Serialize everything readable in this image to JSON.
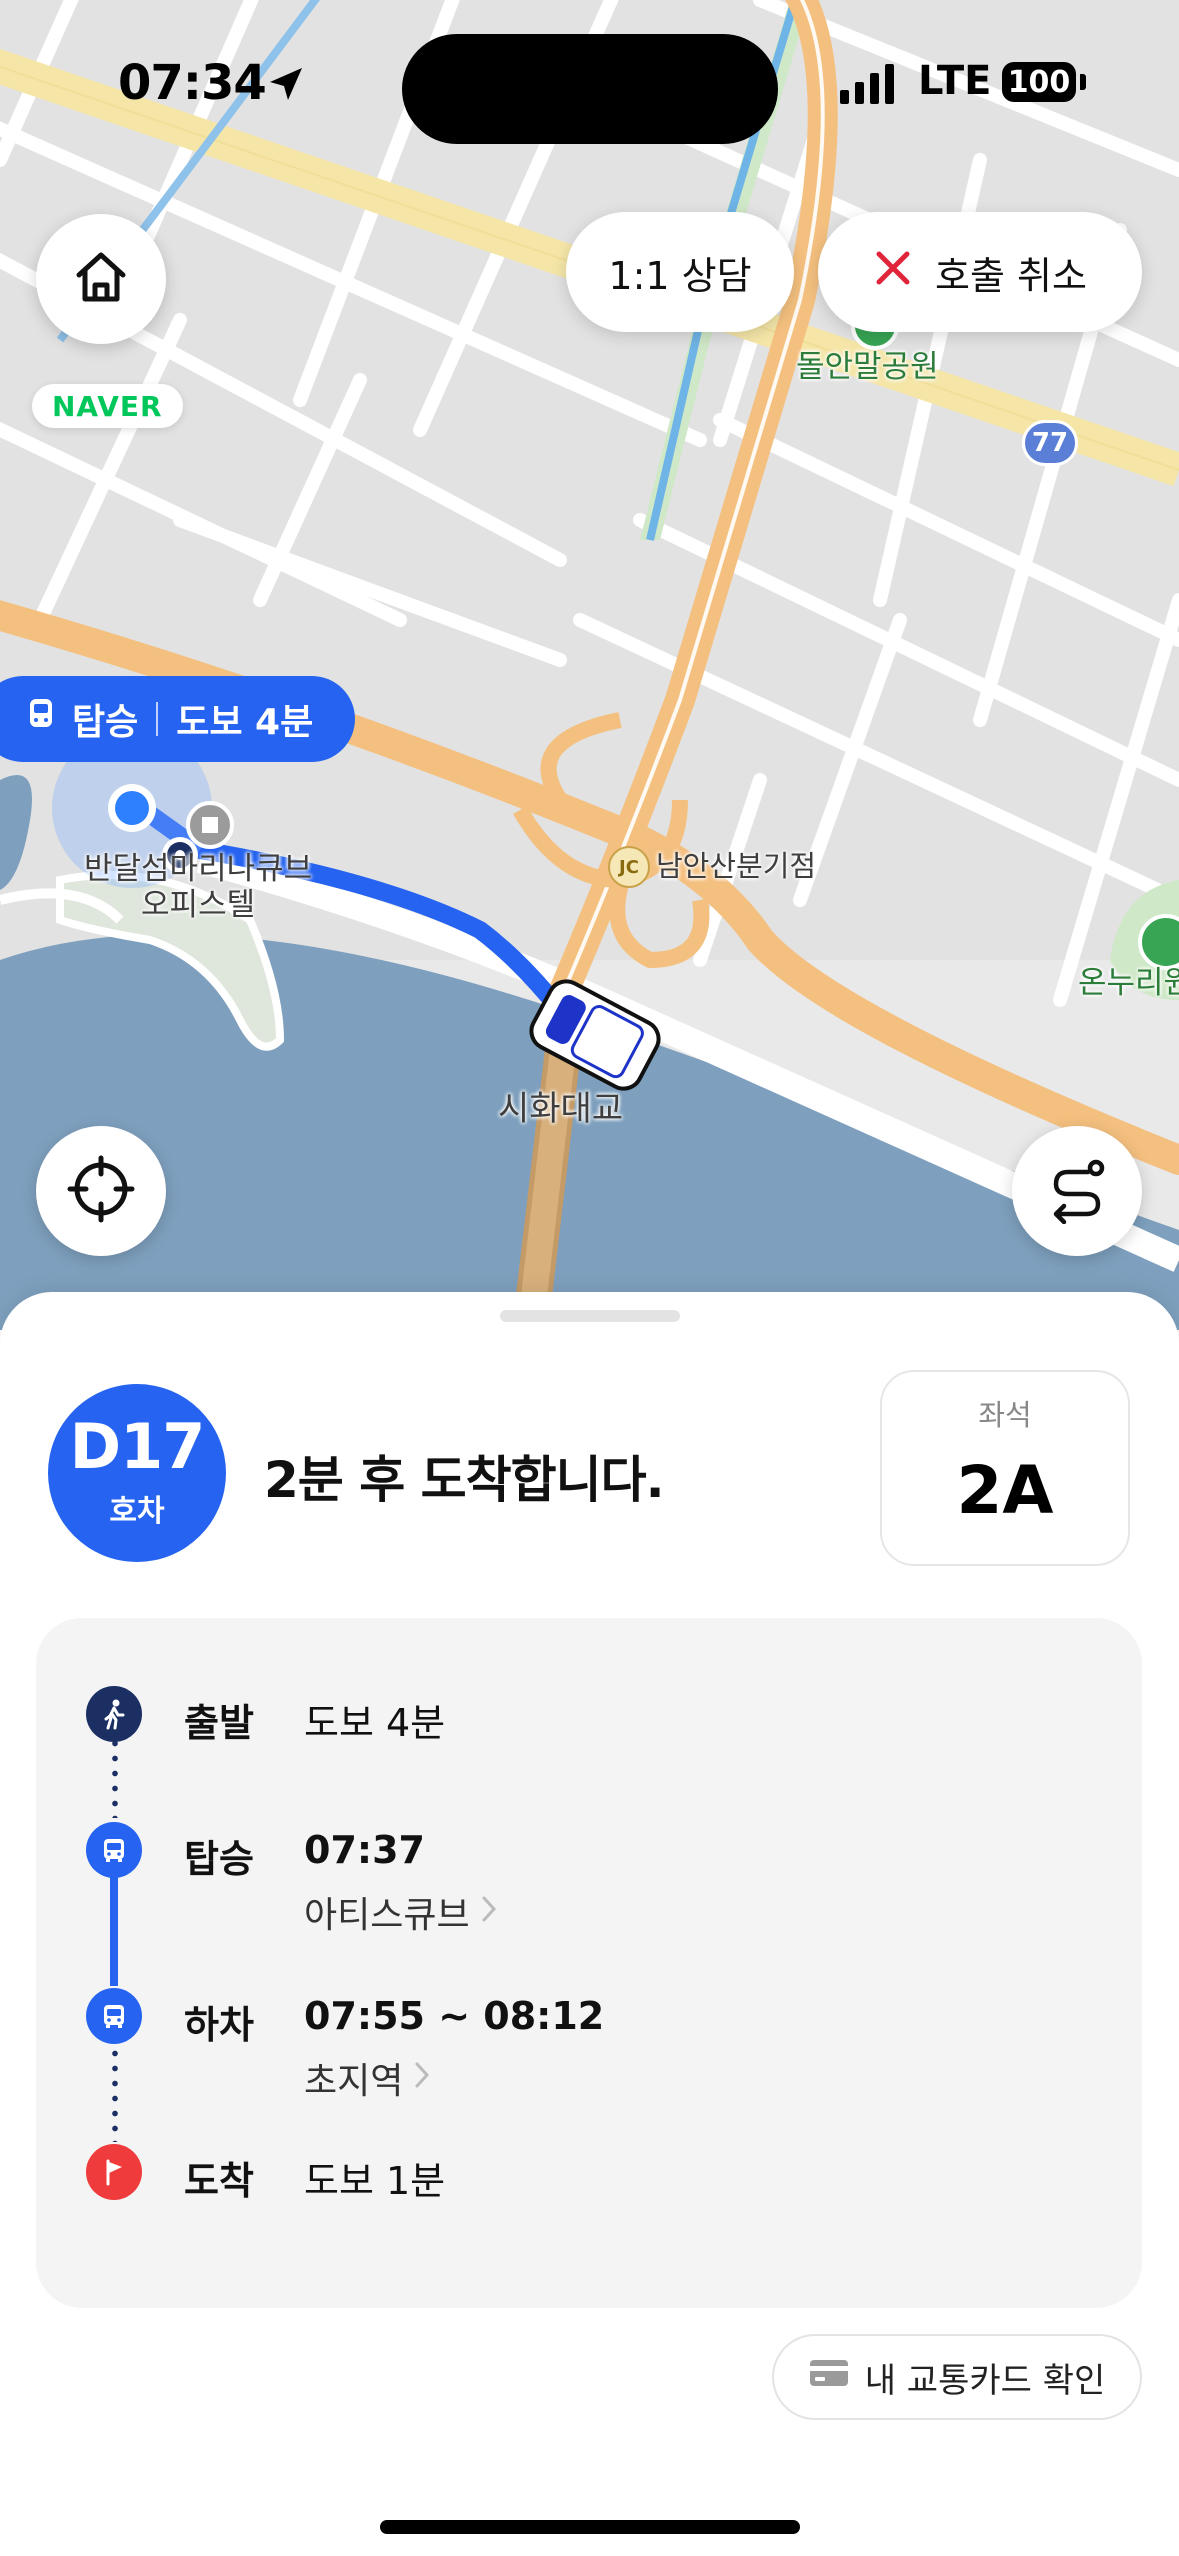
{
  "status_bar": {
    "time": "07:34",
    "network": "LTE",
    "battery": "100"
  },
  "map": {
    "labels": {
      "park": "돌안말공원",
      "junction": "남안산분기점",
      "junction_badge": "JC",
      "building": "반달섬마리나큐브\n오피스텔",
      "bridge": "시화대교",
      "park2": "온누리원"
    },
    "route_number": "77",
    "naver_logo": "NAVER",
    "board_tag": {
      "action": "탑승",
      "walk": "도보 4분"
    }
  },
  "buttons": {
    "consult": "1:1 상담",
    "cancel": "호출 취소"
  },
  "icons": {
    "home": "home-icon",
    "locate": "locate-icon",
    "route": "route-icon",
    "close": "close-icon",
    "walk": "walk-icon",
    "bus": "bus-icon",
    "flag": "flag-icon",
    "card": "card-icon"
  },
  "colors": {
    "accent": "#2563f0",
    "cancel_red": "#e0253a",
    "flag_red": "#ef3b3b",
    "navy": "#1b2f63",
    "naver_green": "#03c75a"
  },
  "vehicle": {
    "number": "D17",
    "unit": "호차"
  },
  "arrival": "2분 후 도착합니다.",
  "seat": {
    "label": "좌석",
    "value": "2A"
  },
  "itinerary": {
    "depart": {
      "title": "출발",
      "detail": "도보 4분"
    },
    "board": {
      "title": "탑승",
      "time": "07:37",
      "stop": "아티스큐브"
    },
    "alight": {
      "title": "하차",
      "time": "07:55 ~ 08:12",
      "stop": "초지역"
    },
    "arrive": {
      "title": "도착",
      "detail": "도보 1분"
    }
  },
  "card_check": "내 교통카드 확인"
}
